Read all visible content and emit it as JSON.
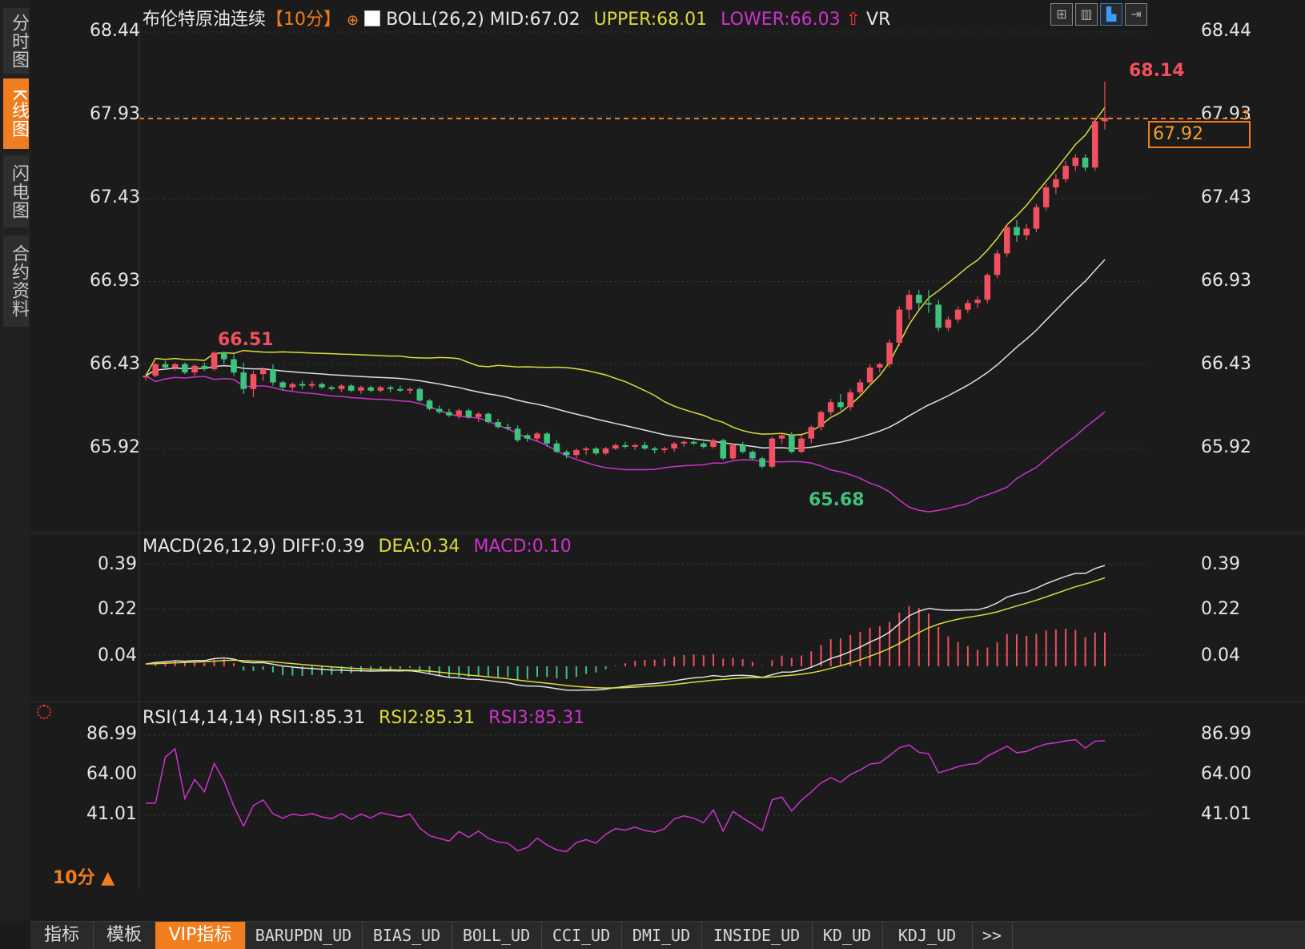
{
  "sidebar": {
    "tabs": [
      {
        "label": "分时图",
        "active": false
      },
      {
        "label": "K线图",
        "active": true
      },
      {
        "label": "闪电图",
        "active": false
      },
      {
        "label": "合约资料",
        "active": false
      }
    ]
  },
  "header": {
    "title": "布伦特原油连续",
    "period_tag": "【10分】",
    "indicator": "BOLL(26,2)",
    "mid": "MID:67.02",
    "upper": "UPPER:68.01",
    "lower": "LOWER:66.03",
    "vr": "VR"
  },
  "colors": {
    "up": "#f0505f",
    "down": "#3fc27e",
    "upper": "#dcdc3a",
    "mid": "#e0e0e0",
    "lower": "#cc33cc",
    "accent": "#f07d1e",
    "grid": "#3a3a3a"
  },
  "price_axis": [
    "68.44",
    "67.93",
    "67.43",
    "66.93",
    "66.43",
    "65.92"
  ],
  "annotations": {
    "high_label": "68.14",
    "low_label": "65.68",
    "left_high_label": "66.51",
    "current_price": "67.92"
  },
  "macd": {
    "title": "MACD(26,12,9)",
    "diff": "DIFF:0.39",
    "dea": "DEA:0.34",
    "macd": "MACD:0.10",
    "axis": [
      "0.39",
      "0.22",
      "0.04"
    ]
  },
  "rsi": {
    "title": "RSI(14,14,14)",
    "rsi1": "RSI1:85.31",
    "rsi2": "RSI2:85.31",
    "rsi3": "RSI3:85.31",
    "axis": [
      "86.99",
      "64.00",
      "41.01"
    ]
  },
  "period_selector": "10分 ▲",
  "bottom_tabs": [
    {
      "label": "指标",
      "active": false
    },
    {
      "label": "模板",
      "active": false
    },
    {
      "label": "VIP指标",
      "active": true
    },
    {
      "label": "BARUPDN_UD",
      "active": false
    },
    {
      "label": "BIAS_UD",
      "active": false
    },
    {
      "label": "BOLL_UD",
      "active": false
    },
    {
      "label": "CCI_UD",
      "active": false
    },
    {
      "label": "DMI_UD",
      "active": false
    },
    {
      "label": "INSIDE_UD",
      "active": false
    },
    {
      "label": "KD_UD",
      "active": false
    },
    {
      "label": "KDJ_UD",
      "active": false
    },
    {
      "label": ">>",
      "active": false
    }
  ],
  "toolbar_icons": [
    "grid-layout-icon",
    "chart-layout-icon",
    "candle-layout-icon",
    "forward-icon"
  ],
  "chart_data": {
    "type": "candlestick",
    "interval": "10分",
    "ylim": [
      65.72,
      68.44
    ],
    "candles_ohlc": [
      [
        66.35,
        66.37,
        66.33,
        66.36
      ],
      [
        66.36,
        66.44,
        66.35,
        66.43
      ],
      [
        66.43,
        66.45,
        66.4,
        66.41
      ],
      [
        66.41,
        66.44,
        66.39,
        66.43
      ],
      [
        66.43,
        66.44,
        66.37,
        66.38
      ],
      [
        66.38,
        66.43,
        66.36,
        66.42
      ],
      [
        66.42,
        66.44,
        66.39,
        66.4
      ],
      [
        66.4,
        66.51,
        66.39,
        66.5
      ],
      [
        66.5,
        66.5,
        66.43,
        66.46
      ],
      [
        66.46,
        66.49,
        66.36,
        66.38
      ],
      [
        66.38,
        66.44,
        66.25,
        66.28
      ],
      [
        66.28,
        66.39,
        66.23,
        66.37
      ],
      [
        66.37,
        66.41,
        66.33,
        66.4
      ],
      [
        66.4,
        66.43,
        66.3,
        66.32
      ],
      [
        66.32,
        66.33,
        66.27,
        66.29
      ],
      [
        66.29,
        66.32,
        66.27,
        66.31
      ],
      [
        66.31,
        66.33,
        66.28,
        66.3
      ],
      [
        66.3,
        66.33,
        66.28,
        66.31
      ],
      [
        66.31,
        66.32,
        66.28,
        66.29
      ],
      [
        66.29,
        66.3,
        66.27,
        66.28
      ],
      [
        66.28,
        66.31,
        66.26,
        66.3
      ],
      [
        66.3,
        66.31,
        66.26,
        66.27
      ],
      [
        66.27,
        66.3,
        66.25,
        66.29
      ],
      [
        66.29,
        66.3,
        66.26,
        66.27
      ],
      [
        66.27,
        66.3,
        66.26,
        66.29
      ],
      [
        66.29,
        66.3,
        66.26,
        66.28
      ],
      [
        66.28,
        66.3,
        66.26,
        66.27
      ],
      [
        66.27,
        66.29,
        66.25,
        66.28
      ],
      [
        66.28,
        66.29,
        66.2,
        66.21
      ],
      [
        66.21,
        66.22,
        66.15,
        66.16
      ],
      [
        66.16,
        66.18,
        66.13,
        66.14
      ],
      [
        66.14,
        66.16,
        66.11,
        66.12
      ],
      [
        66.12,
        66.16,
        66.1,
        66.15
      ],
      [
        66.15,
        66.16,
        66.1,
        66.11
      ],
      [
        66.11,
        66.14,
        66.08,
        66.13
      ],
      [
        66.13,
        66.14,
        66.07,
        66.08
      ],
      [
        66.08,
        66.1,
        66.04,
        66.05
      ],
      [
        66.05,
        66.07,
        66.03,
        66.04
      ],
      [
        66.04,
        66.06,
        65.96,
        65.97
      ],
      [
        66.0,
        66.01,
        65.96,
        65.98
      ],
      [
        65.98,
        66.02,
        65.96,
        66.01
      ],
      [
        66.01,
        66.02,
        65.93,
        65.95
      ],
      [
        65.95,
        65.97,
        65.89,
        65.9
      ],
      [
        65.9,
        65.91,
        65.86,
        65.88
      ],
      [
        65.88,
        65.92,
        65.86,
        65.91
      ],
      [
        65.91,
        65.93,
        65.88,
        65.92
      ],
      [
        65.92,
        65.93,
        65.88,
        65.89
      ],
      [
        65.89,
        65.93,
        65.88,
        65.92
      ],
      [
        65.92,
        65.95,
        65.91,
        65.94
      ],
      [
        65.94,
        65.96,
        65.92,
        65.93
      ],
      [
        65.93,
        65.95,
        65.91,
        65.94
      ],
      [
        65.94,
        65.96,
        65.91,
        65.92
      ],
      [
        65.92,
        65.93,
        65.89,
        65.91
      ],
      [
        65.91,
        65.93,
        65.89,
        65.92
      ],
      [
        65.92,
        65.96,
        65.9,
        65.95
      ],
      [
        65.95,
        65.97,
        65.93,
        65.96
      ],
      [
        65.96,
        65.97,
        65.94,
        65.95
      ],
      [
        65.95,
        65.96,
        65.92,
        65.93
      ],
      [
        65.93,
        65.98,
        65.92,
        65.97
      ],
      [
        65.97,
        65.98,
        65.85,
        65.86
      ],
      [
        65.86,
        65.95,
        65.85,
        65.94
      ],
      [
        65.94,
        65.96,
        65.89,
        65.9
      ],
      [
        65.9,
        65.91,
        65.85,
        65.86
      ],
      [
        65.86,
        65.87,
        65.8,
        65.81
      ],
      [
        65.81,
        65.99,
        65.8,
        65.98
      ],
      [
        65.98,
        66.01,
        65.95,
        66.0
      ],
      [
        66.0,
        66.02,
        65.89,
        65.9
      ],
      [
        65.9,
        66.0,
        65.89,
        65.98
      ],
      [
        65.98,
        66.06,
        65.95,
        66.05
      ],
      [
        66.05,
        66.15,
        66.03,
        66.14
      ],
      [
        66.14,
        66.22,
        66.12,
        66.2
      ],
      [
        66.2,
        66.25,
        66.15,
        66.17
      ],
      [
        66.17,
        66.28,
        66.15,
        66.26
      ],
      [
        66.26,
        66.34,
        66.24,
        66.32
      ],
      [
        66.32,
        66.43,
        66.3,
        66.41
      ],
      [
        66.41,
        66.44,
        66.38,
        66.43
      ],
      [
        66.43,
        66.58,
        66.41,
        66.56
      ],
      [
        66.56,
        66.78,
        66.54,
        66.76
      ],
      [
        66.76,
        66.88,
        66.7,
        66.85
      ],
      [
        66.85,
        66.88,
        66.76,
        66.8
      ],
      [
        66.8,
        66.88,
        66.74,
        66.79
      ],
      [
        66.79,
        66.82,
        66.63,
        66.65
      ],
      [
        66.65,
        66.72,
        66.63,
        66.7
      ],
      [
        66.7,
        66.78,
        66.68,
        66.76
      ],
      [
        66.76,
        66.82,
        66.74,
        66.8
      ],
      [
        66.8,
        66.84,
        66.77,
        66.82
      ],
      [
        66.82,
        66.98,
        66.8,
        66.97
      ],
      [
        66.97,
        67.12,
        66.95,
        67.1
      ],
      [
        67.1,
        67.28,
        67.08,
        67.26
      ],
      [
        67.26,
        67.3,
        67.17,
        67.21
      ],
      [
        67.21,
        67.28,
        67.18,
        67.25
      ],
      [
        67.25,
        67.4,
        67.23,
        67.38
      ],
      [
        67.38,
        67.52,
        67.36,
        67.5
      ],
      [
        67.5,
        67.58,
        67.46,
        67.55
      ],
      [
        67.55,
        67.66,
        67.53,
        67.63
      ],
      [
        67.63,
        67.7,
        67.6,
        67.68
      ],
      [
        67.68,
        67.7,
        67.6,
        67.62
      ],
      [
        67.62,
        67.92,
        67.6,
        67.9
      ],
      [
        67.9,
        68.14,
        67.85,
        67.92
      ]
    ],
    "boll": {
      "mid": 67.02,
      "upper": 68.01,
      "lower": 66.03
    },
    "macd": {
      "diff": 0.39,
      "dea": 0.34,
      "macd": 0.1
    },
    "rsi": {
      "rsi1": 85.31,
      "rsi2": 85.31,
      "rsi3": 85.31
    }
  }
}
